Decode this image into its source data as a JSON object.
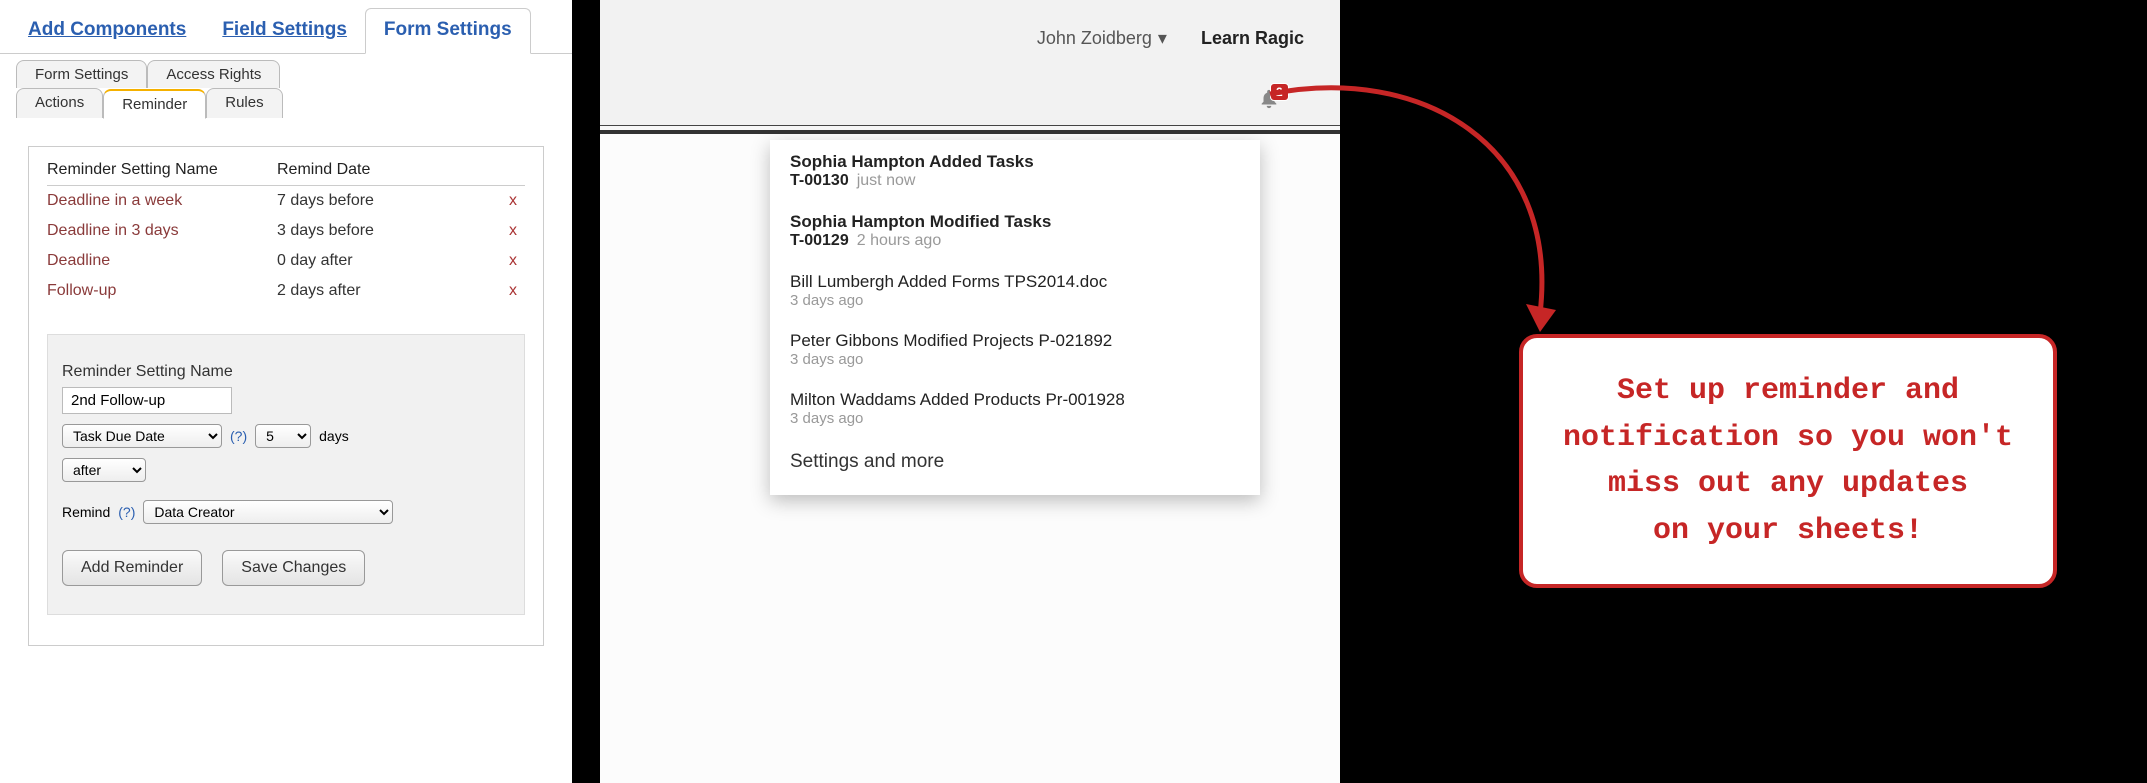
{
  "topTabs": {
    "addComponents": "Add Components",
    "fieldSettings": "Field Settings",
    "formSettings": "Form Settings"
  },
  "subTabs": {
    "formSettings": "Form Settings",
    "accessRights": "Access Rights",
    "actions": "Actions",
    "reminder": "Reminder",
    "rules": "Rules"
  },
  "reminderTable": {
    "headName": "Reminder Setting Name",
    "headDate": "Remind Date",
    "rows": [
      {
        "name": "Deadline in a week",
        "date": "7 days before",
        "x": "x"
      },
      {
        "name": "Deadline in 3 days",
        "date": "3 days before",
        "x": "x"
      },
      {
        "name": "Deadline",
        "date": "0 day after",
        "x": "x"
      },
      {
        "name": "Follow-up",
        "date": "2 days after",
        "x": "x"
      }
    ]
  },
  "form": {
    "nameLabel": "Reminder Setting Name",
    "nameValue": "2nd Follow-up",
    "dateField": "Task Due Date",
    "help": "(?)",
    "daysValue": "5",
    "daysLabel": "days",
    "afterValue": "after",
    "remindLabel": "Remind",
    "remindHelp": "(?)",
    "remindTarget": "Data Creator",
    "addBtn": "Add Reminder",
    "saveBtn": "Save Changes"
  },
  "user": {
    "name": "John Zoidberg",
    "learn": "Learn Ragic",
    "badge": "2"
  },
  "notifications": {
    "items": [
      {
        "title": "Sophia Hampton Added Tasks",
        "sub": "T-00130",
        "time": "just now",
        "bold": true
      },
      {
        "title": "Sophia Hampton Modified Tasks",
        "sub": "T-00129",
        "time": "2 hours ago",
        "bold": true
      },
      {
        "title": "Bill Lumbergh Added Forms TPS2014.doc",
        "sub": "",
        "time": "3 days ago",
        "bold": false
      },
      {
        "title": "Peter Gibbons Modified Projects P-021892",
        "sub": "",
        "time": "3 days ago",
        "bold": false
      },
      {
        "title": "Milton Waddams Added Products Pr-001928",
        "sub": "",
        "time": "3 days ago",
        "bold": false
      }
    ],
    "footer": "Settings and more"
  },
  "callout": "Set up reminder and\nnotification so you won't\nmiss out any updates\non your sheets!"
}
